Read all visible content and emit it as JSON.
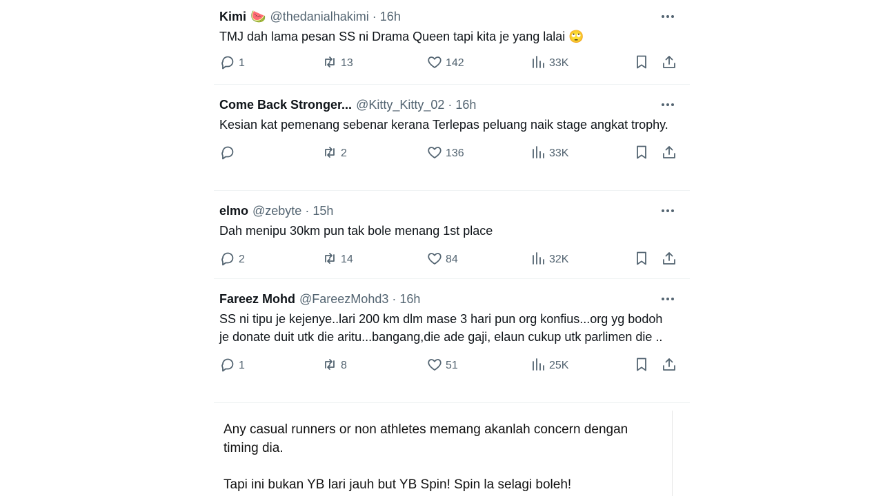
{
  "tweets": [
    {
      "name": "Kimi",
      "emoji": "🍉",
      "handle": "@thedanialhakimi",
      "time": "16h",
      "text": "TMJ dah lama pesan SS ni Drama Queen tapi kita je yang lalai 🙄",
      "replies": "1",
      "retweets": "13",
      "likes": "142",
      "views": "33K"
    },
    {
      "name": "Come Back Stronger...",
      "emoji": "",
      "handle": "@Kitty_Kitty_02",
      "time": "16h",
      "text": "Kesian kat pemenang sebenar kerana Terlepas peluang naik stage angkat trophy.",
      "replies": "",
      "retweets": "2",
      "likes": "136",
      "views": "33K"
    },
    {
      "name": "elmo",
      "emoji": "",
      "handle": "@zebyte",
      "time": "15h",
      "text": "Dah menipu 30km pun tak bole menang 1st place",
      "replies": "2",
      "retweets": "14",
      "likes": "84",
      "views": "32K"
    },
    {
      "name": "Fareez Mohd",
      "emoji": "",
      "handle": "@FareezMohd3",
      "time": "16h",
      "text": "SS ni tipu je kejenye..lari 200 km dlm mase 3 hari pun org konfius...org yg bodoh je donate duit utk die aritu...bangang,die ade gaji, elaun cukup utk parlimen die ..",
      "replies": "1",
      "retweets": "8",
      "likes": "51",
      "views": "25K"
    }
  ],
  "separator": "·",
  "card": {
    "paragraph1": "Any casual runners or non athletes memang akanlah concern dengan timing dia.",
    "paragraph2": "Tapi ini bukan YB lari jauh but YB Spin! Spin la selagi boleh!"
  },
  "icons": {
    "reply": "reply-icon",
    "retweet": "retweet-icon",
    "like": "heart-icon",
    "views": "views-icon",
    "bookmark": "bookmark-icon",
    "share": "share-icon",
    "more": "more-dots-icon"
  },
  "colors": {
    "text": "#0f1419",
    "secondary": "#536471",
    "divider": "#eff3f4"
  }
}
